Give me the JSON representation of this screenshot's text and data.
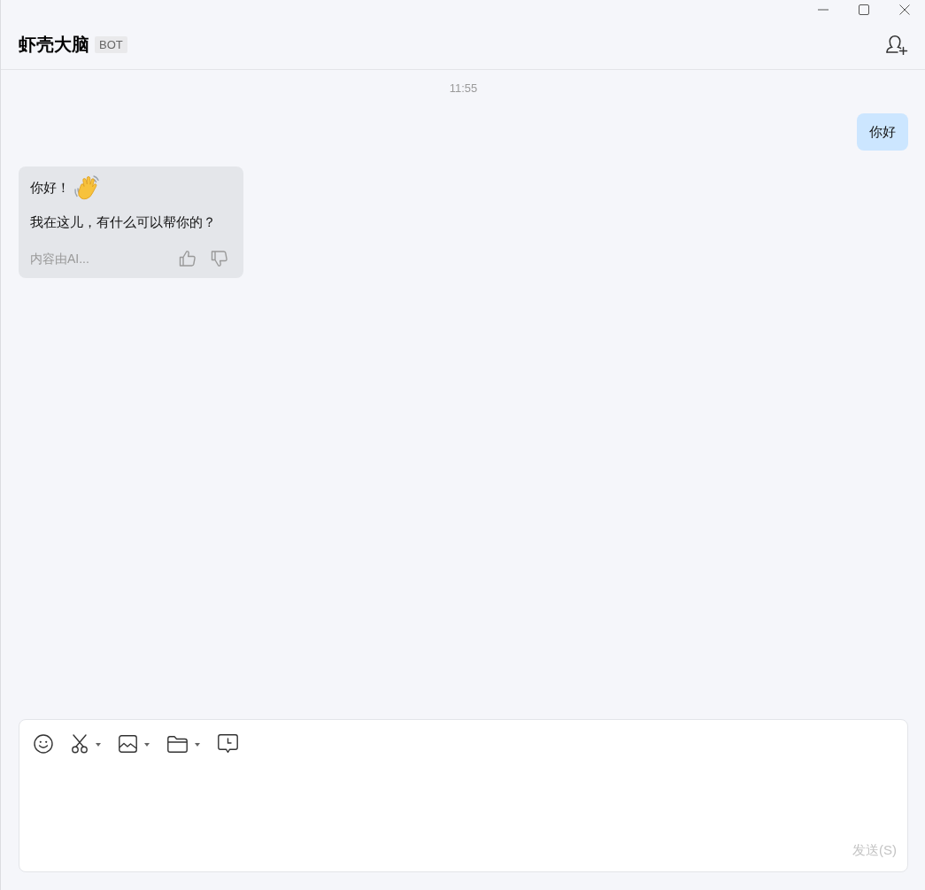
{
  "header": {
    "title": "虾壳大脑",
    "badge": "BOT"
  },
  "messages": [
    {
      "kind": "time",
      "text": "11:55"
    },
    {
      "kind": "user",
      "paragraphs": [
        "你好"
      ]
    },
    {
      "kind": "bot",
      "paragraphs": [
        "你好！",
        "我在这儿，有什么可以帮你的？"
      ],
      "note": "内容由AI..."
    }
  ],
  "composer": {
    "send_button": {
      "label": "发送(S)",
      "disabled": true
    }
  }
}
